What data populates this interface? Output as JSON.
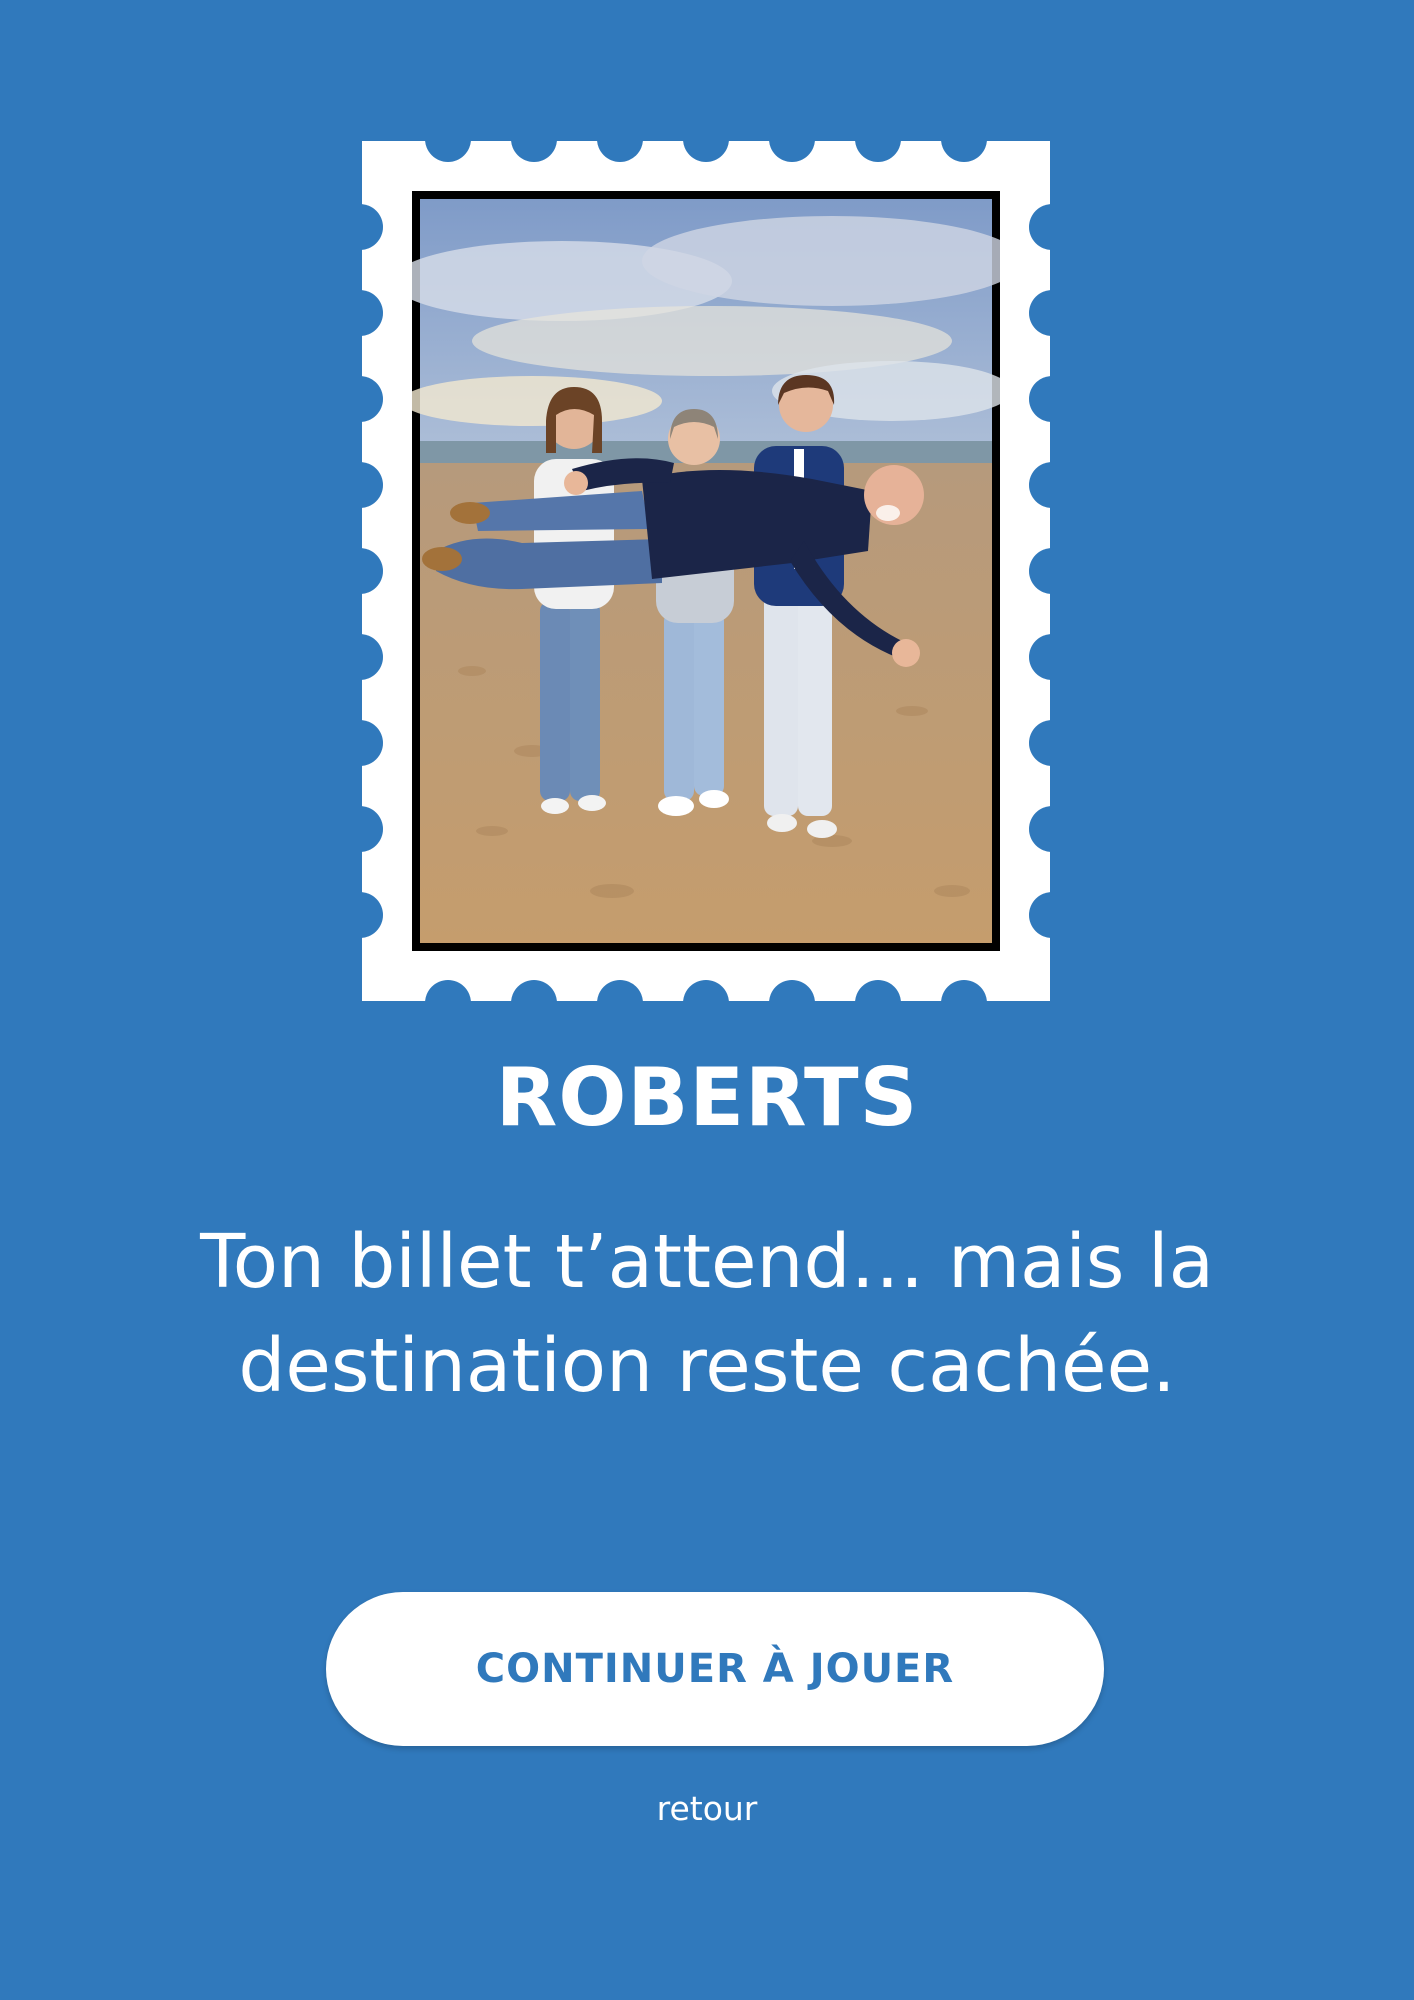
{
  "stamp": {
    "photo_alt": "Quatre personnes sur une plage tenant un homme à l'horizontale"
  },
  "title": "ROBERTS",
  "message": "Ton billet t’attend… mais la destination reste cachée.",
  "continue_button": {
    "label": "CONTINUER À JOUER"
  },
  "back_link": "retour",
  "colors": {
    "background": "#3079bc",
    "stamp": "#ffffff",
    "button_text": "#3079bc"
  }
}
